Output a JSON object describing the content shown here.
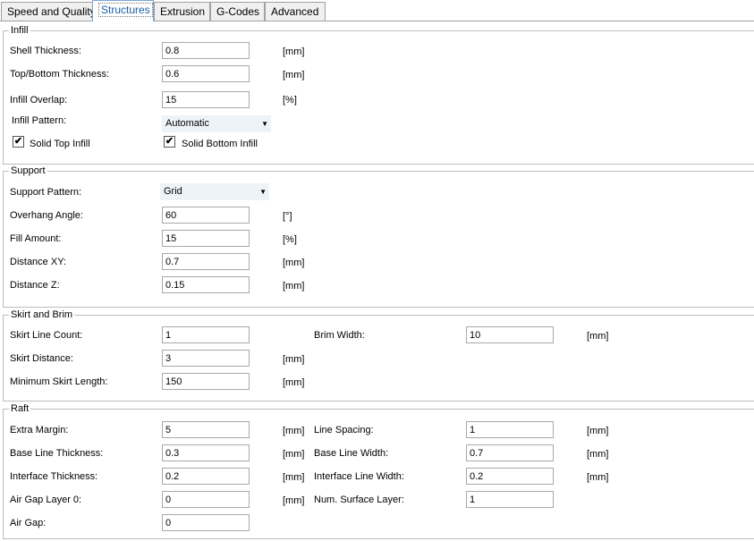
{
  "tabs": [
    "Speed and Quality",
    "Structures",
    "Extrusion",
    "G-Codes",
    "Advanced"
  ],
  "infill": {
    "title": "Infill",
    "shell_label": "Shell Thickness:",
    "shell_value": "0.8",
    "shell_unit": "[mm]",
    "topbottom_label": "Top/Bottom Thickness:",
    "topbottom_value": "0.6",
    "topbottom_unit": "[mm]",
    "overlap_label": "Infill Overlap:",
    "overlap_value": "15",
    "overlap_unit": "[%]",
    "pattern_label": "Infill Pattern:",
    "pattern_value": "Automatic",
    "solid_top_label": "Solid Top Infill",
    "solid_top_checked": true,
    "solid_bottom_label": "Solid Bottom Infill",
    "solid_bottom_checked": true
  },
  "support": {
    "title": "Support",
    "pattern_label": "Support Pattern:",
    "pattern_value": "Grid",
    "overhang_label": "Overhang Angle:",
    "overhang_value": "60",
    "overhang_unit": "[°]",
    "fill_label": "Fill Amount:",
    "fill_value": "15",
    "fill_unit": "[%]",
    "dxy_label": "Distance XY:",
    "dxy_value": "0.7",
    "dxy_unit": "[mm]",
    "dz_label": "Distance Z:",
    "dz_value": "0.15",
    "dz_unit": "[mm]"
  },
  "skirt": {
    "title": "Skirt and Brim",
    "count_label": "Skirt Line Count:",
    "count_value": "1",
    "distance_label": "Skirt Distance:",
    "distance_value": "3",
    "distance_unit": "[mm]",
    "minlen_label": "Minimum Skirt Length:",
    "minlen_value": "150",
    "minlen_unit": "[mm]",
    "brim_label": "Brim Width:",
    "brim_value": "10",
    "brim_unit": "[mm]"
  },
  "raft": {
    "title": "Raft",
    "margin_label": "Extra Margin:",
    "margin_value": "5",
    "margin_unit": "[mm]",
    "baseline_label": "Base Line Thickness:",
    "baseline_value": "0.3",
    "baseline_unit": "[mm]",
    "interface_label": "Interface Thickness:",
    "interface_value": "0.2",
    "interface_unit": "[mm]",
    "airgap0_label": "Air Gap Layer 0:",
    "airgap0_value": "0",
    "airgap0_unit": "[mm]",
    "airgap_label": "Air Gap:",
    "airgap_value": "0",
    "spacing_label": "Line Spacing:",
    "spacing_value": "1",
    "spacing_unit": "[mm]",
    "basewidth_label": "Base Line Width:",
    "basewidth_value": "0.7",
    "basewidth_unit": "[mm]",
    "ifacewidth_label": "Interface Line Width:",
    "ifacewidth_value": "0.2",
    "ifacewidth_unit": "[mm]",
    "surface_label": "Num. Surface Layer:",
    "surface_value": "1"
  }
}
